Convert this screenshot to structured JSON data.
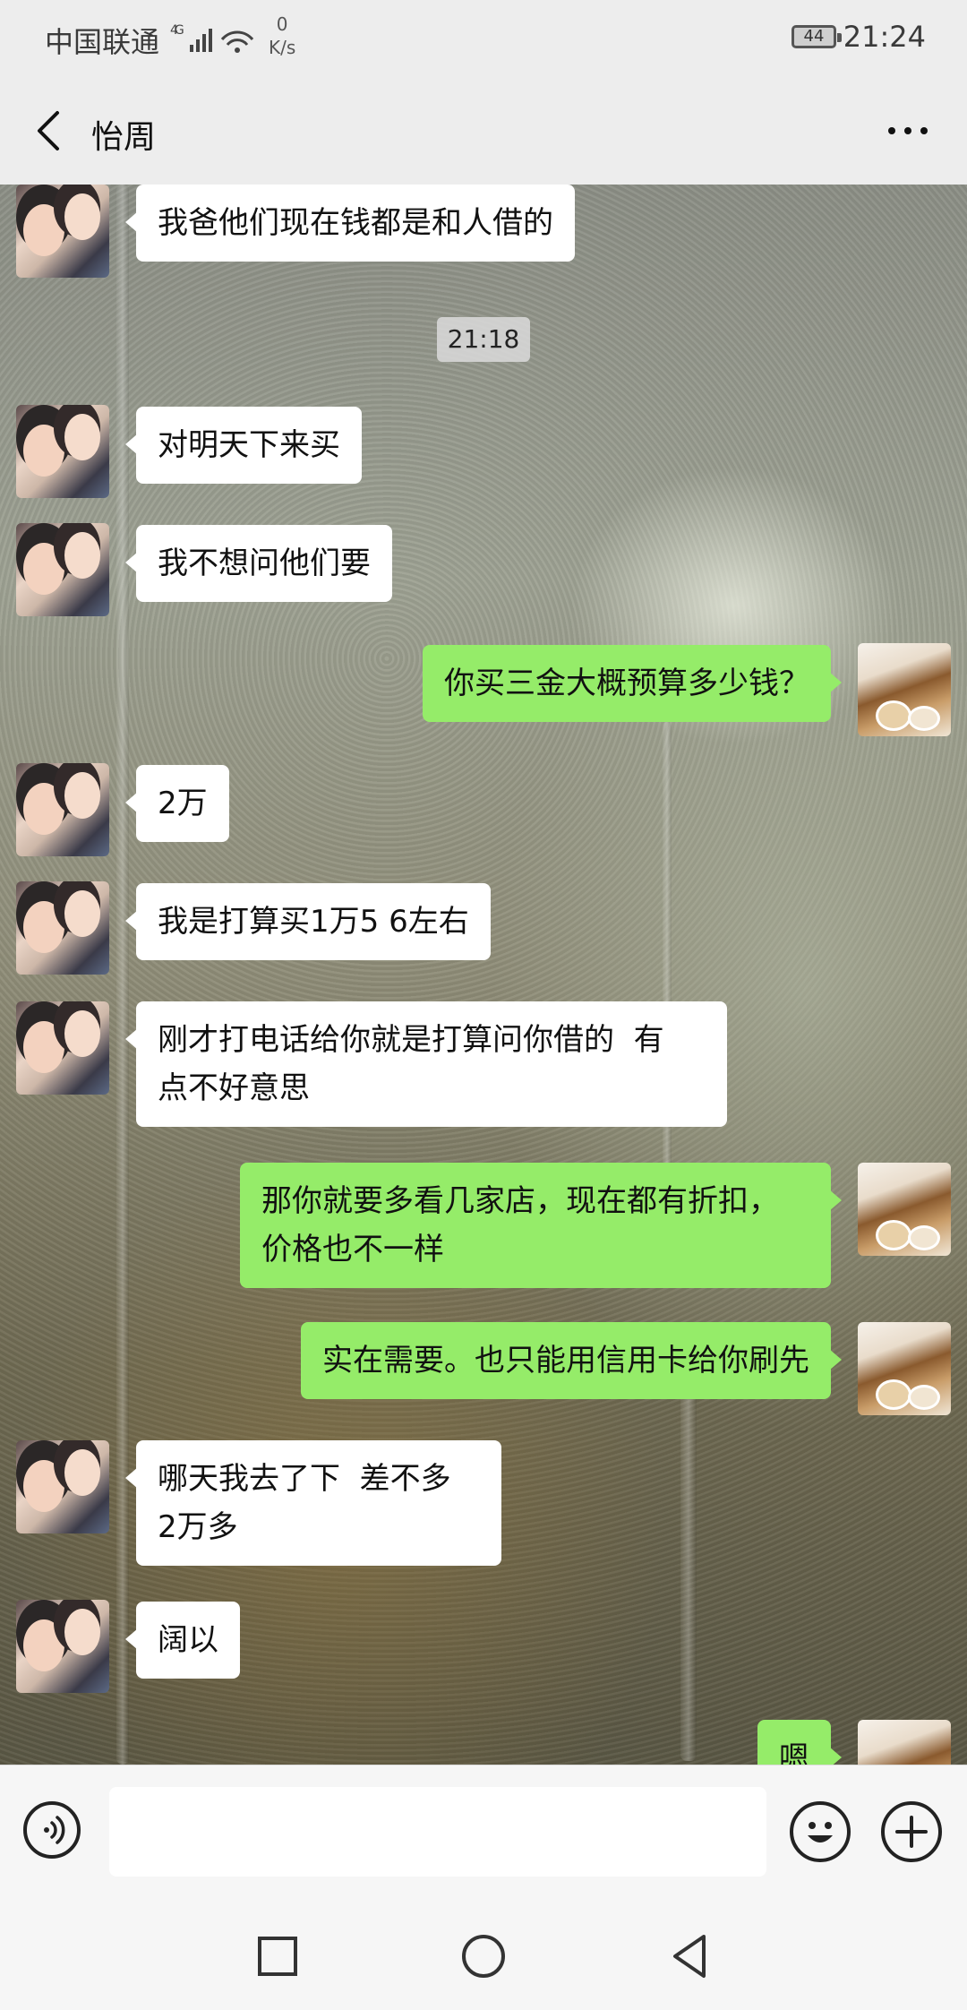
{
  "status_bar": {
    "carrier": "中国联通",
    "network": "4G",
    "net_speed_value": "0",
    "net_speed_unit": "K/s",
    "battery": "44",
    "time": "21:24"
  },
  "header": {
    "title": "怡周",
    "back_icon": "chevron-left-icon",
    "more_icon": "more-dots-icon"
  },
  "messages": [
    {
      "side": "in",
      "text": "我爸他们现在钱都是和人借的"
    },
    {
      "type": "time",
      "text": "21:18"
    },
    {
      "side": "in",
      "text": "对明天下来买"
    },
    {
      "side": "in",
      "text": "我不想问他们要"
    },
    {
      "side": "out",
      "text": "你买三金大概预算多少钱？"
    },
    {
      "side": "in",
      "text": "2万"
    },
    {
      "side": "in",
      "text": "我是打算买1万5 6左右"
    },
    {
      "side": "in",
      "text": "刚才打电话给你就是打算问你借的  有\n点不好意思"
    },
    {
      "side": "out",
      "text": "那你就要多看几家店，现在都有折扣，\n价格也不一样"
    },
    {
      "side": "out",
      "text": "实在需要。也只能用信用卡给你刷先"
    },
    {
      "side": "in",
      "text": "哪天我去了下  差不多\n2万多"
    },
    {
      "side": "in",
      "text": "阔以"
    },
    {
      "side": "out",
      "text": "嗯"
    }
  ],
  "input_bar": {
    "voice_icon": "voice-icon",
    "emoji_icon": "emoji-icon",
    "plus_icon": "plus-icon",
    "text_value": ""
  },
  "nav_bar": {
    "recents_icon": "square-icon",
    "home_icon": "circle-icon",
    "back_icon": "triangle-back-icon"
  },
  "colors": {
    "out_bubble": "#95ec69",
    "in_bubble": "#ffffff",
    "bar_bg": "#ededed"
  }
}
